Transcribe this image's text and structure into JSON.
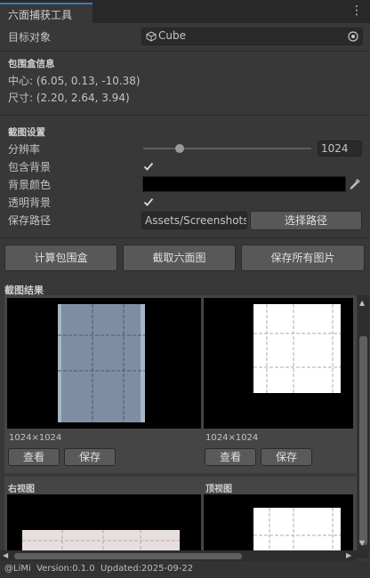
{
  "window": {
    "tab_title": "六面捕获工具"
  },
  "target": {
    "label": "目标对象",
    "value": "Cube",
    "object_icon": "cube-icon",
    "picker_icon": "target-picker-icon"
  },
  "bounds": {
    "heading": "包围盒信息",
    "center": "中心: (6.05, 0.13, -10.38)",
    "size": "尺寸: (2.20, 2.64, 3.94)"
  },
  "capture": {
    "heading": "截图设置",
    "resolution_label": "分辨率",
    "resolution_value": "1024",
    "include_bg_label": "包含背景",
    "include_bg_checked": true,
    "bg_color_label": "背景颜色",
    "bg_color": "#000000",
    "transparent_label": "透明背景",
    "transparent_checked": true,
    "save_path_label": "保存路径",
    "save_path_value": "Assets/Screenshots",
    "choose_path_button": "选择路径"
  },
  "actions": {
    "calc_bounds": "计算包围盒",
    "capture_six": "截取六面图",
    "save_all": "保存所有图片"
  },
  "results": {
    "heading": "截图结果",
    "cards": [
      {
        "title": "",
        "size": "1024×1024",
        "view_button": "查看",
        "save_button": "保存",
        "image_style": "bluegrey"
      },
      {
        "title": "",
        "size": "1024×1024",
        "view_button": "查看",
        "save_button": "保存",
        "image_style": "white"
      },
      {
        "title": "右视图",
        "image_style": "pink-partial"
      },
      {
        "title": "顶视图",
        "image_style": "white-partial"
      }
    ]
  },
  "footer": {
    "text": "@LiMi  Version:0.1.0  Updated:2025-09-22"
  },
  "colors": {
    "accent": "#3a79bb",
    "panel": "#383838",
    "dark": "#282828"
  }
}
